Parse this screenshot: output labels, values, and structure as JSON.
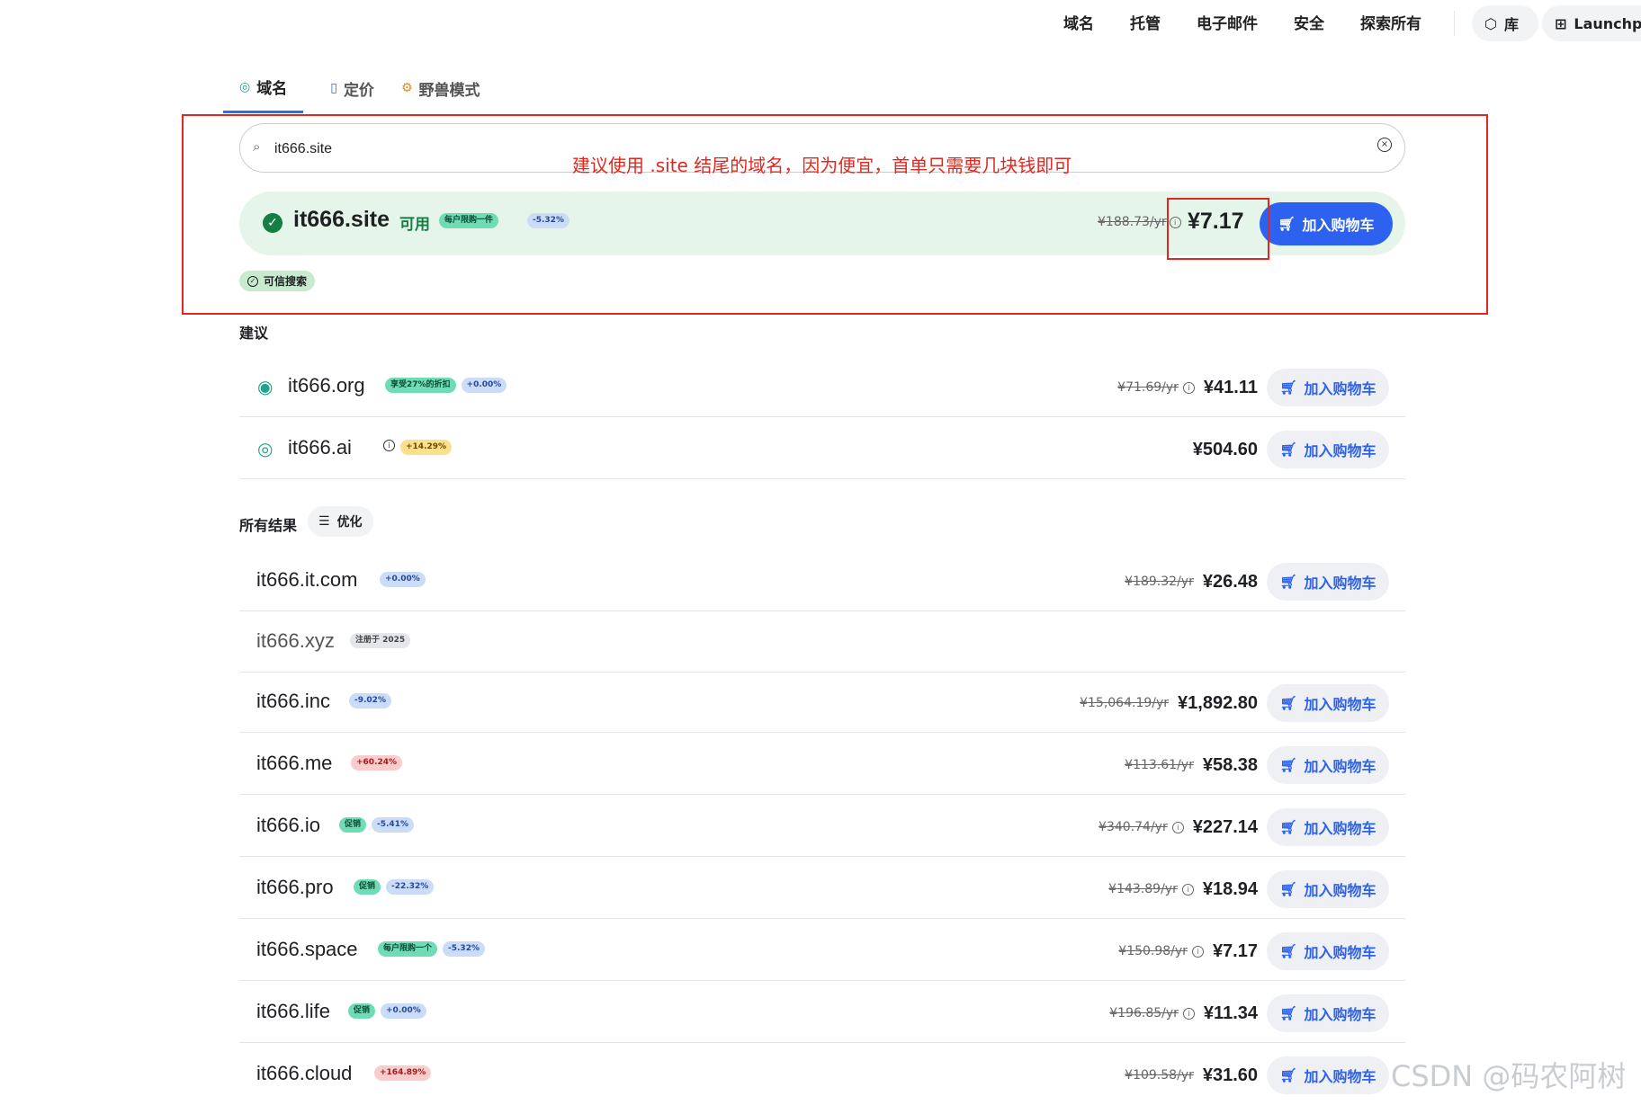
{
  "nav": {
    "links": [
      "域名",
      "托管",
      "电子邮件",
      "安全",
      "探索所有"
    ],
    "library_label": "库",
    "launchpad_label": "Launchpa"
  },
  "tabs": [
    {
      "label": "域名",
      "icon": "domain-icon"
    },
    {
      "label": "定价",
      "icon": "pricing-icon"
    },
    {
      "label": "野兽模式",
      "icon": "beast-mode-icon"
    }
  ],
  "search": {
    "value": "it666.site",
    "placeholder": ""
  },
  "annotation": "建议使用 .site 结尾的域名，因为便宜，首单只需要几块钱即可",
  "hero": {
    "domain": "it666.site",
    "status": "可用",
    "badges": [
      {
        "text": "每户限购一件",
        "color": "green"
      },
      {
        "text": "-5.32%",
        "color": "blue"
      }
    ],
    "old_price": "¥188.73/yr",
    "price": "¥7.17",
    "add_label": "加入购物车"
  },
  "trusted_label": "可信搜索",
  "suggestions_title": "建议",
  "suggestions": [
    {
      "domain": "it666.org",
      "badges": [
        {
          "text": "享受27%的折扣",
          "color": "green"
        },
        {
          "text": "+0.00%",
          "color": "blue"
        }
      ],
      "old_price": "¥71.69/yr",
      "price": "¥41.11",
      "add_label": "加入购物车"
    },
    {
      "domain": "it666.ai",
      "badges": [
        {
          "text": "+14.29%",
          "color": "yellow"
        }
      ],
      "old_price": "",
      "price": "¥504.60",
      "add_label": "加入购物车"
    }
  ],
  "results_title": "所有结果",
  "refine_label": "优化",
  "results": [
    {
      "domain": "it666.it.com",
      "badges": [
        {
          "text": "+0.00%",
          "color": "blue"
        }
      ],
      "old_price": "¥189.32/yr",
      "price": "¥26.48",
      "add_label": "加入购物车"
    },
    {
      "domain": "it666.xyz",
      "badges": [
        {
          "text": "注册于 2025",
          "color": "gray"
        }
      ],
      "old_price": "",
      "price": "",
      "add_label": ""
    },
    {
      "domain": "it666.inc",
      "badges": [
        {
          "text": "-9.02%",
          "color": "blue"
        }
      ],
      "old_price": "¥15,064.19/yr",
      "price": "¥1,892.80",
      "add_label": "加入购物车"
    },
    {
      "domain": "it666.me",
      "badges": [
        {
          "text": "+60.24%",
          "color": "red"
        }
      ],
      "old_price": "¥113.61/yr",
      "price": "¥58.38",
      "add_label": "加入购物车"
    },
    {
      "domain": "it666.io",
      "badges": [
        {
          "text": "促销",
          "color": "green"
        },
        {
          "text": "-5.41%",
          "color": "blue"
        }
      ],
      "old_price": "¥340.74/yr",
      "price": "¥227.14",
      "add_label": "加入购物车"
    },
    {
      "domain": "it666.pro",
      "badges": [
        {
          "text": "促销",
          "color": "green"
        },
        {
          "text": "-22.32%",
          "color": "blue"
        }
      ],
      "old_price": "¥143.89/yr",
      "price": "¥18.94",
      "add_label": "加入购物车"
    },
    {
      "domain": "it666.space",
      "badges": [
        {
          "text": "每户限购一个",
          "color": "green"
        },
        {
          "text": "-5.32%",
          "color": "blue"
        }
      ],
      "old_price": "¥150.98/yr",
      "price": "¥7.17",
      "add_label": "加入购物车"
    },
    {
      "domain": "it666.life",
      "badges": [
        {
          "text": "促销",
          "color": "green"
        },
        {
          "text": "+0.00%",
          "color": "blue"
        }
      ],
      "old_price": "¥196.85/yr",
      "price": "¥11.34",
      "add_label": "加入购物车"
    },
    {
      "domain": "it666.cloud",
      "badges": [
        {
          "text": "+164.89%",
          "color": "red"
        }
      ],
      "old_price": "¥109.58/yr",
      "price": "¥31.60",
      "add_label": "加入购物车"
    }
  ],
  "watermark": "CSDN @码农阿树",
  "colors": {
    "accent": "#2d62f0",
    "available_green": "#157f43",
    "annotation_red": "#e0281f"
  }
}
